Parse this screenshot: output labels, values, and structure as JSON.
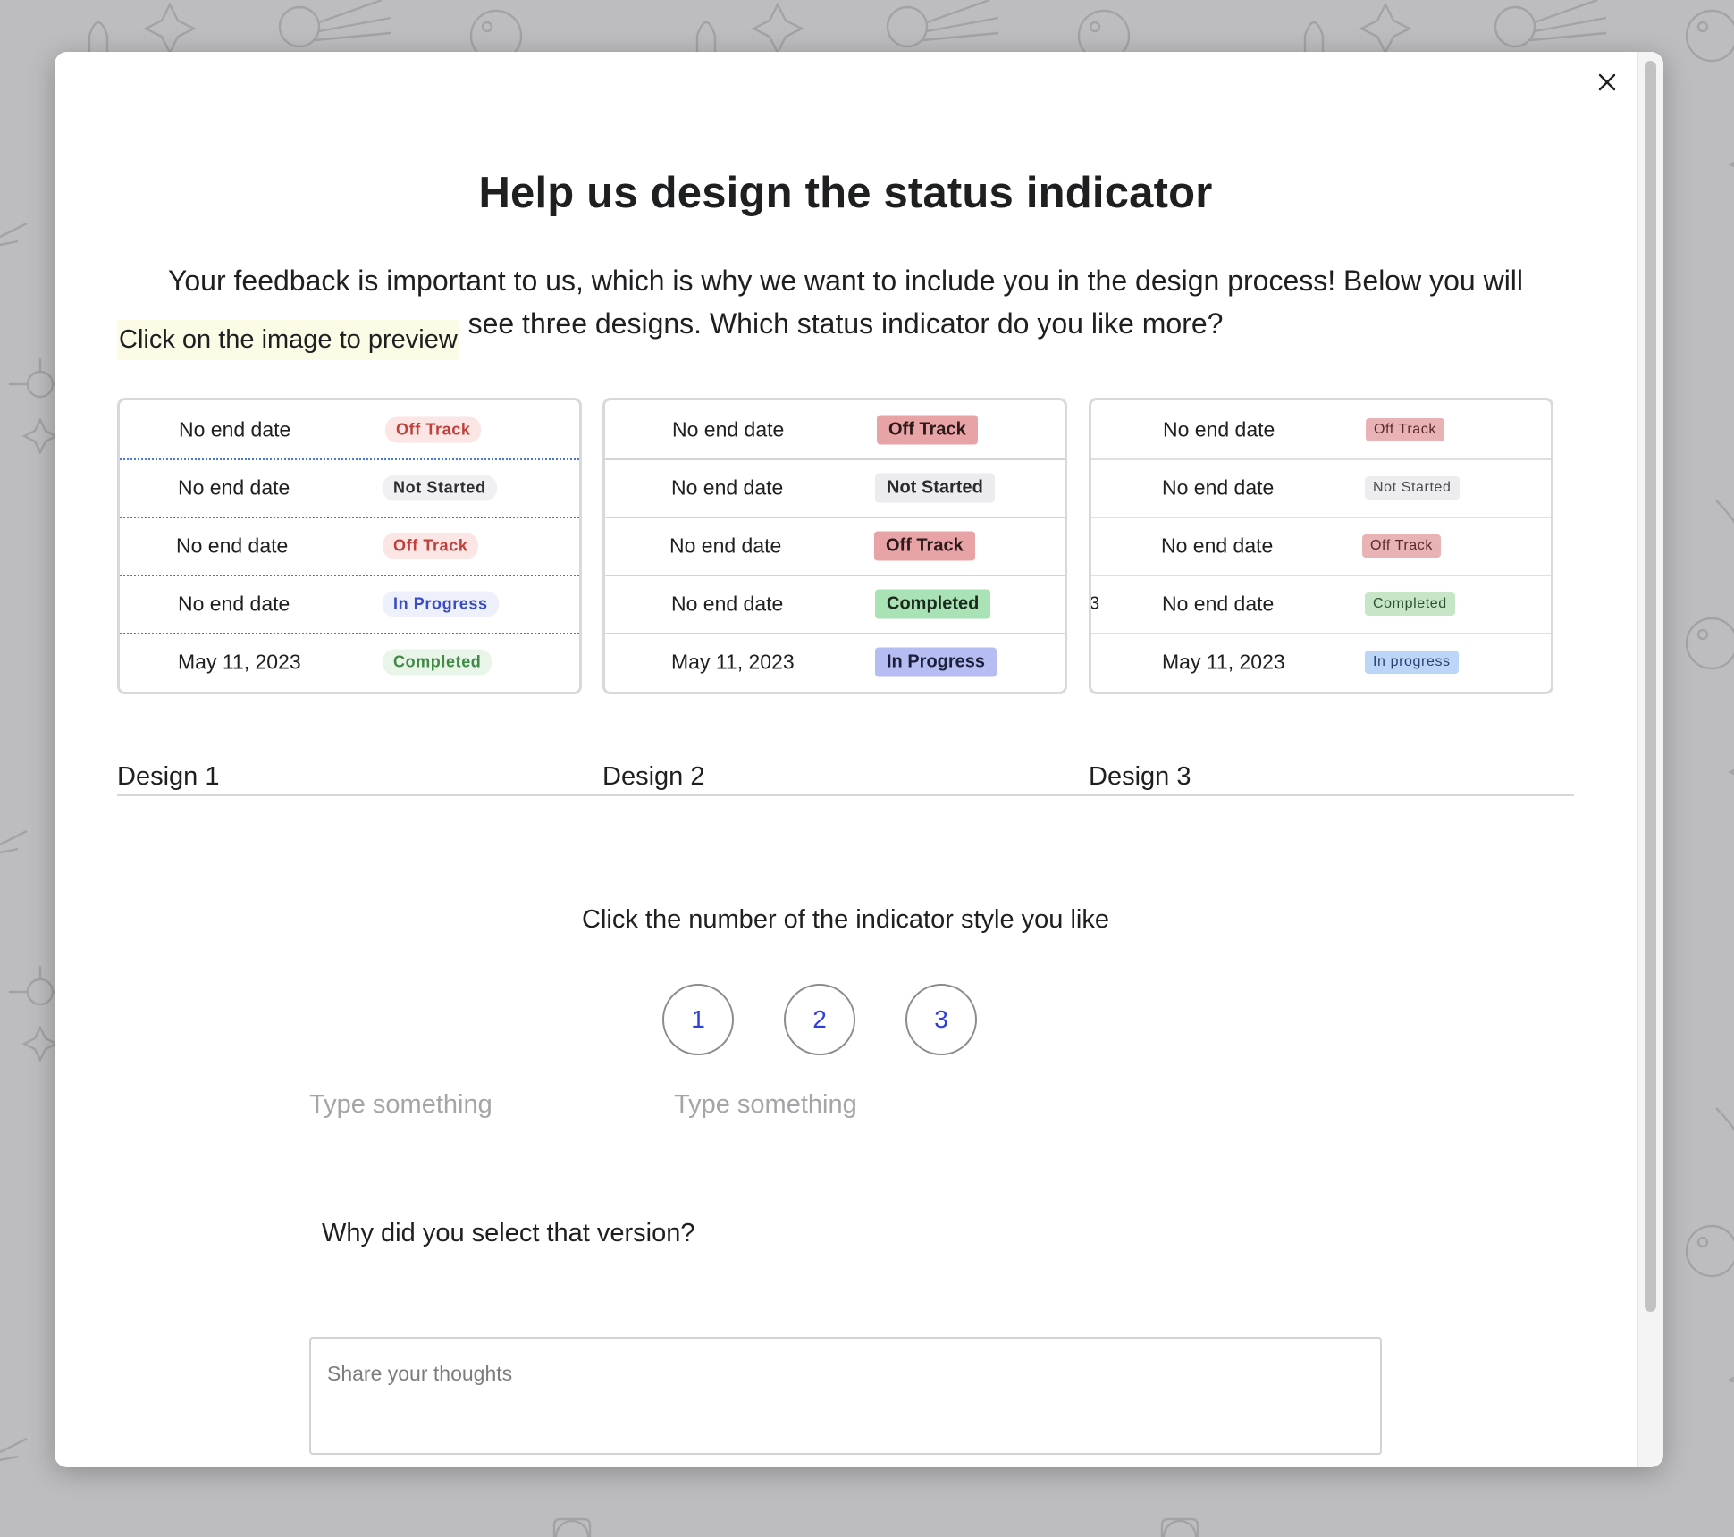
{
  "modal": {
    "title": "Help us design the status indicator",
    "intro": "Your feedback is important to us, which is why we want to include you in the design process! Below you will see three designs. Which status indicator do you like more?",
    "hint": "Click on the image to preview",
    "close_icon": "close-icon"
  },
  "designs": [
    {
      "label": "Design 1",
      "rows": [
        {
          "date": "No end date",
          "status": "Off Track"
        },
        {
          "date": "No end date",
          "status": "Not Started"
        },
        {
          "date": "No end date",
          "status": "Off Track"
        },
        {
          "date": "No end date",
          "status": "In Progress"
        },
        {
          "date": "May 11, 2023",
          "status": "Completed"
        }
      ]
    },
    {
      "label": "Design 2",
      "rows": [
        {
          "date": "No end date",
          "status": "Off Track"
        },
        {
          "date": "No end date",
          "status": "Not Started"
        },
        {
          "date": "No end date",
          "status": "Off Track"
        },
        {
          "date": "No end date",
          "status": "Completed"
        },
        {
          "date": "May 11, 2023",
          "status": "In Progress"
        }
      ]
    },
    {
      "label": "Design 3",
      "edge_fragment": "3",
      "rows": [
        {
          "date": "No end date",
          "status": "Off Track"
        },
        {
          "date": "No end date",
          "status": "Not Started"
        },
        {
          "date": "No end date",
          "status": "Off Track"
        },
        {
          "date": "No end date",
          "status": "Completed"
        },
        {
          "date": "May 11, 2023",
          "status": "In progress"
        }
      ]
    }
  ],
  "vote": {
    "question": "Click the number of the indicator style you like",
    "options": [
      "1",
      "2",
      "3"
    ],
    "low_label": "Type something",
    "high_label": "Type something"
  },
  "feedback": {
    "question": "Why did you select that version?",
    "placeholder": "Share your thoughts"
  },
  "colors": {
    "backdrop": "#bdbdbf",
    "accent": "#2d40d8",
    "off_track": "#e8a3a6",
    "completed": "#a9e2b4",
    "in_progress": "#b5bdf3",
    "not_started": "#ececee"
  }
}
